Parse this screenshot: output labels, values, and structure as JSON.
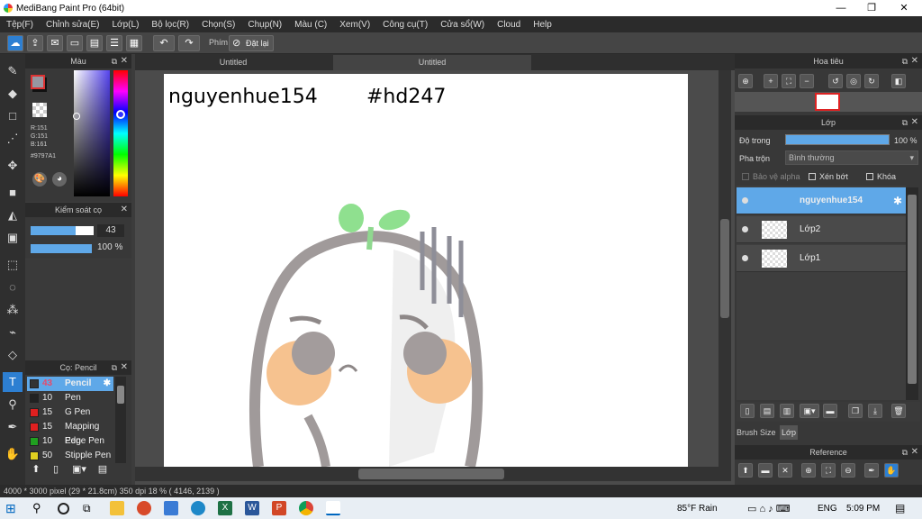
{
  "window": {
    "title": "MediBang Paint Pro (64bit)",
    "minimize": "—",
    "maximize": "❐",
    "close": "✕"
  },
  "menu": [
    "Tệp(F)",
    "Chỉnh sửa(E)",
    "Lớp(L)",
    "Bộ lọc(R)",
    "Chọn(S)",
    "Chụp(N)",
    "Màu (C)",
    "Xem(V)",
    "Công cụ(T)",
    "Cửa sổ(W)",
    "Cloud",
    "Help"
  ],
  "toolbar": {
    "shortcut_label": "Phím",
    "reset_label": "Đặt lại"
  },
  "color_panel": {
    "title": "Màu",
    "r": "R:151",
    "g": "G:151",
    "b": "B:161",
    "hex": "#9797A1",
    "fg_color": "#9797a1"
  },
  "brush_control": {
    "title": "Kiểm soát cọ",
    "size": "43",
    "opacity": "100 %",
    "size_fraction": 0.72,
    "opacity_fraction": 1.0
  },
  "brush_panel": {
    "title": "Cọ: Pencil",
    "items": [
      {
        "size": "43",
        "name": "Pencil",
        "color": "#333333",
        "selected": true
      },
      {
        "size": "10",
        "name": "Pen",
        "color": "#222222"
      },
      {
        "size": "15",
        "name": "G Pen",
        "color": "#e02020"
      },
      {
        "size": "15",
        "name": "Mapping Pen",
        "color": "#e02020"
      },
      {
        "size": "10",
        "name": "Edge Pen",
        "color": "#20a020"
      },
      {
        "size": "50",
        "name": "Stipple Pen",
        "color": "#e0d020"
      }
    ]
  },
  "tabs": [
    "Untitled",
    "Untitled"
  ],
  "canvas": {
    "text_left": "nguyenhue154",
    "text_right": "#hd247"
  },
  "navigator": {
    "title": "Hoa tiêu"
  },
  "layers_panel": {
    "title": "Lớp",
    "opacity_label": "Độ trong",
    "opacity_value": "100 %",
    "blend_label": "Pha trộn",
    "blend_value": "Bình thường",
    "protect_alpha": "Bảo vệ alpha",
    "clipping": "Xén bớt",
    "lock": "Khóa",
    "layers": [
      {
        "name": "nguyenhue154",
        "selected": true
      },
      {
        "name": "Lớp2"
      },
      {
        "name": "Lớp1"
      }
    ],
    "tab_brush_size": "Brush Size",
    "tab_layer": "Lớp"
  },
  "reference": {
    "title": "Reference"
  },
  "status": {
    "text": "4000 * 3000 pixel   (29 * 21.8cm)   350 dpi   18 %   ( 4146, 2139 )"
  },
  "taskbar": {
    "weather": "85°F  Rain",
    "lang": "ENG",
    "time": "5:09 PM"
  }
}
